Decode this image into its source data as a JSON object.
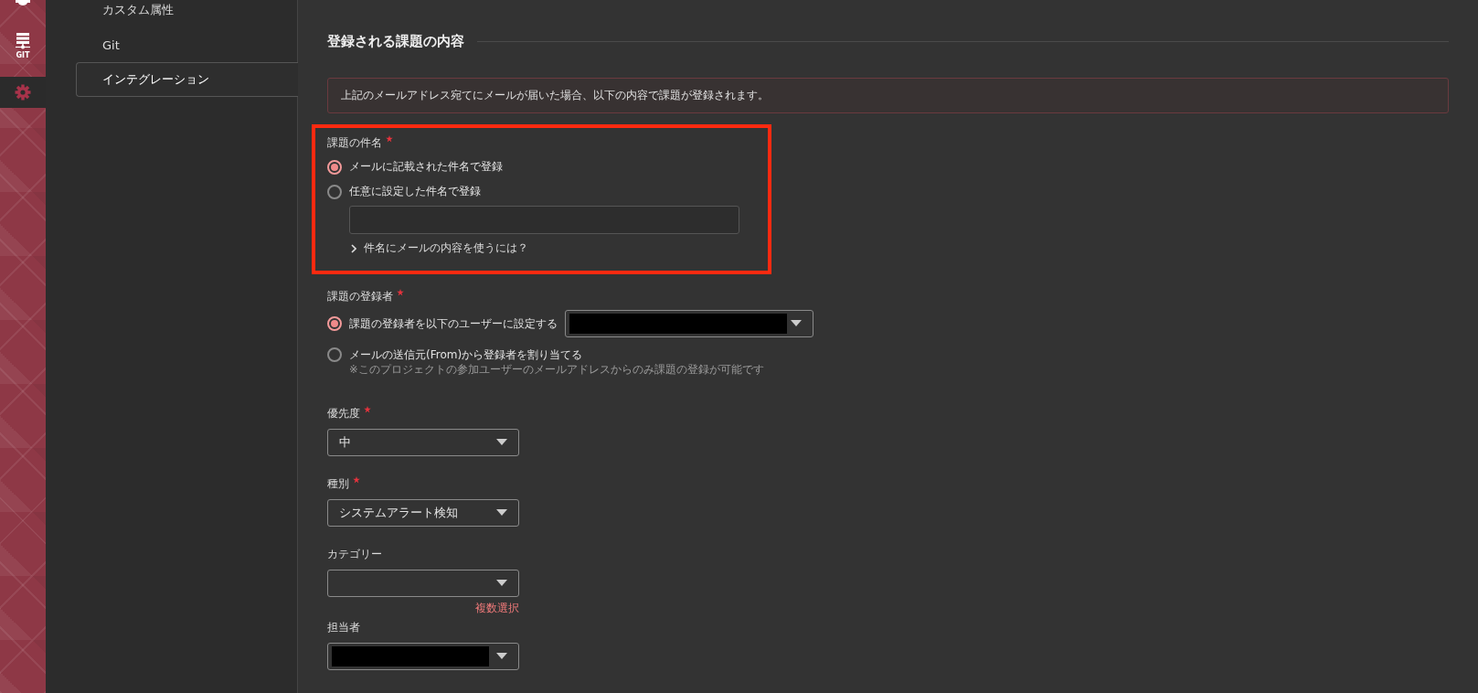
{
  "rail": [
    {
      "kind": "partial",
      "selected": false
    },
    {
      "kind": "git",
      "label": "GIT",
      "selected": false
    },
    {
      "kind": "gear",
      "selected": true
    }
  ],
  "sidebar": {
    "items": [
      {
        "label": "カスタム属性",
        "selected": false
      },
      {
        "label": "Git",
        "selected": false
      },
      {
        "label": "インテグレーション",
        "selected": true
      }
    ]
  },
  "section_title": "登録される課題の内容",
  "notice": "上記のメールアドレス宛てにメールが届いた場合、以下の内容で課題が登録されます。",
  "fields": [
    {
      "kind": "radio-group",
      "label": "課題の件名",
      "required": true,
      "highlighted": true,
      "options": [
        {
          "label": "メールに記載された件名で登録",
          "selected": true
        },
        {
          "label": "任意に設定した件名で登録",
          "selected": false,
          "has_input": true
        }
      ],
      "expander": "件名にメールの内容を使うには？"
    },
    {
      "kind": "radio-group",
      "label": "課題の登録者",
      "required": true,
      "highlighted": false,
      "options": [
        {
          "label": "課題の登録者を以下のユーザーに設定する",
          "selected": true,
          "select": {
            "redacted": true
          }
        },
        {
          "label": "メールの送信元(From)から登録者を割り当てる",
          "selected": false,
          "note": "※このプロジェクトの参加ユーザーのメールアドレスからのみ課題の登録が可能です"
        }
      ]
    },
    {
      "kind": "select",
      "label": "優先度",
      "required": true,
      "value": "中"
    },
    {
      "kind": "select",
      "label": "種別",
      "required": true,
      "value": "システムアラート検知"
    },
    {
      "kind": "select",
      "label": "カテゴリー",
      "required": false,
      "link": "複数選択"
    },
    {
      "kind": "select",
      "label": "担当者",
      "required": false,
      "redacted": true
    }
  ]
}
